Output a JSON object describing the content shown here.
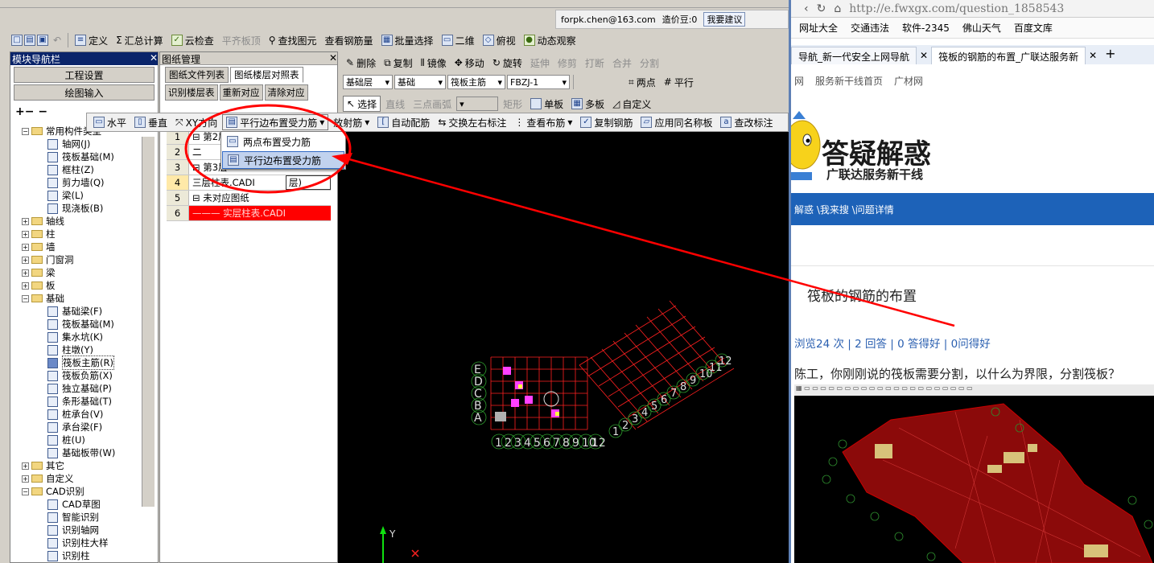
{
  "app": {
    "user_email": "forpk.chen@163.com",
    "price_bean": "造价豆:0",
    "suggest": "我要建议",
    "toolbar1": [
      "定义",
      "汇总计算",
      "云检查",
      "平齐板顶",
      "查找图元",
      "查看钢筋量",
      "批量选择",
      "二维",
      "俯视",
      "动态观察"
    ],
    "toolbar2": [
      "删除",
      "复制",
      "镜像",
      "移动",
      "旋转",
      "延伸",
      "修剪",
      "打断",
      "合并",
      "分割"
    ],
    "toolbar3": {
      "layer": "基础层",
      "category": "基础",
      "type": "筏板主筋",
      "id": "FBZJ-1",
      "two_point": "两点",
      "parallel": "平行"
    },
    "toolbar4": [
      "选择",
      "直线",
      "三点画弧",
      "矩形",
      "单板",
      "多板",
      "自定义"
    ],
    "float_toolbar": [
      "水平",
      "垂直",
      "XY方向",
      "平行边布置受力筋",
      "放射筋",
      "自动配筋",
      "交换左右标注",
      "查看布筋",
      "复制钢筋",
      "应用同名称板",
      "查改标注"
    ],
    "menu": [
      "两点布置受力筋",
      "平行边布置受力筋"
    ],
    "nav": {
      "title": "模块导航栏",
      "btn_project": "工程设置",
      "btn_draw": "绘图输入",
      "tree": [
        {
          "label": "常用构件类型",
          "level": 0,
          "kind": "folder",
          "expanded": true
        },
        {
          "label": "轴网(J)",
          "level": 1
        },
        {
          "label": "筏板基础(M)",
          "level": 1
        },
        {
          "label": "框柱(Z)",
          "level": 1
        },
        {
          "label": "剪力墙(Q)",
          "level": 1
        },
        {
          "label": "梁(L)",
          "level": 1
        },
        {
          "label": "现浇板(B)",
          "level": 1
        },
        {
          "label": "轴线",
          "level": 0,
          "kind": "folder"
        },
        {
          "label": "柱",
          "level": 0,
          "kind": "folder"
        },
        {
          "label": "墙",
          "level": 0,
          "kind": "folder"
        },
        {
          "label": "门窗洞",
          "level": 0,
          "kind": "folder"
        },
        {
          "label": "梁",
          "level": 0,
          "kind": "folder"
        },
        {
          "label": "板",
          "level": 0,
          "kind": "folder"
        },
        {
          "label": "基础",
          "level": 0,
          "kind": "folder",
          "expanded": true
        },
        {
          "label": "基础梁(F)",
          "level": 1
        },
        {
          "label": "筏板基础(M)",
          "level": 1
        },
        {
          "label": "集水坑(K)",
          "level": 1
        },
        {
          "label": "柱墩(Y)",
          "level": 1
        },
        {
          "label": "筏板主筋(R)",
          "level": 1,
          "selected": true
        },
        {
          "label": "筏板负筋(X)",
          "level": 1
        },
        {
          "label": "独立基础(P)",
          "level": 1
        },
        {
          "label": "条形基础(T)",
          "level": 1
        },
        {
          "label": "桩承台(V)",
          "level": 1
        },
        {
          "label": "承台梁(F)",
          "level": 1
        },
        {
          "label": "桩(U)",
          "level": 1
        },
        {
          "label": "基础板带(W)",
          "level": 1
        },
        {
          "label": "其它",
          "level": 0,
          "kind": "folder"
        },
        {
          "label": "自定义",
          "level": 0,
          "kind": "folder"
        },
        {
          "label": "CAD识别",
          "level": 0,
          "kind": "folder",
          "expanded": true
        },
        {
          "label": "CAD草图",
          "level": 1
        },
        {
          "label": "智能识别",
          "level": 1
        },
        {
          "label": "识别轴网",
          "level": 1
        },
        {
          "label": "识别柱大样",
          "level": 1
        },
        {
          "label": "识别柱",
          "level": 1
        }
      ]
    },
    "dm": {
      "title": "图纸管理",
      "tab1": "图纸文件列表",
      "tab2": "图纸楼层对照表",
      "btn1": "识别楼层表",
      "btn2": "重新对应",
      "btn3": "清除对应",
      "rows": [
        {
          "n": "1",
          "text": "第2层"
        },
        {
          "n": "2",
          "text": "二"
        },
        {
          "n": "3",
          "text": "第3层"
        },
        {
          "n": "4",
          "text": "三层柱表.CADI",
          "extra": "层)"
        },
        {
          "n": "5",
          "text": "未对应图纸"
        },
        {
          "n": "6",
          "text": "——— 实层柱表.CADI",
          "red": true
        }
      ]
    },
    "canvas": {
      "left_axis_labels": [
        "E",
        "D",
        "C",
        "B",
        "A"
      ],
      "bottom_axis_labels": [
        "1",
        "2",
        "3",
        "4",
        "5",
        "6",
        "7",
        "8",
        "9",
        "10",
        "12"
      ],
      "slanted_axis_labels": [
        "1",
        "2",
        "3",
        "4",
        "5",
        "6",
        "7",
        "8",
        "9",
        "10",
        "11",
        "12"
      ],
      "ucs_y": "Y"
    }
  },
  "browser": {
    "url": "http://e.fwxgx.com/question_1858543",
    "bookmarks": [
      "网址大全",
      "交通违法",
      "软件-2345",
      "佛山天气",
      "百度文库"
    ],
    "tabs": [
      "导航_新一代安全上网导航",
      "筏板的钢筋的布置_广联达服务新"
    ],
    "site_nav": [
      "网",
      "服务新干线首页",
      "广材网"
    ],
    "logo_big": "答疑解惑",
    "logo_small": "广联达服务新干线",
    "breadcrumb": "解惑 \\我来搜 \\问题详情",
    "question_title": "筏板的钢筋的布置",
    "stats": "浏览24 次 | 2 回答 | 0 答得好 | 0问得好",
    "question_text": "陈工，你刚刚说的筏板需要分割，以什么为界限，分割筏板？"
  }
}
